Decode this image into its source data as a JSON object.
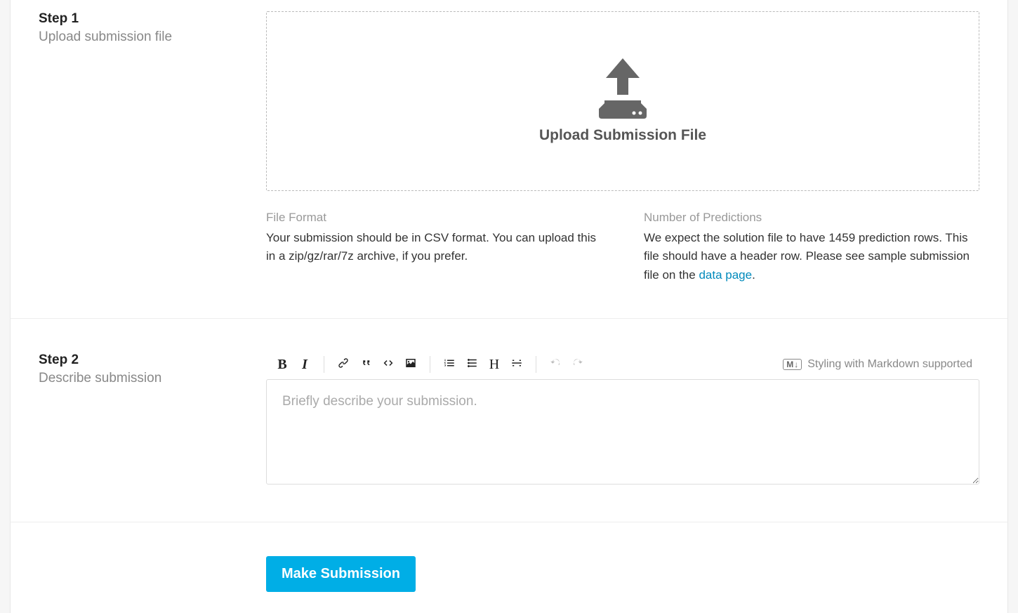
{
  "step1": {
    "num": "Step 1",
    "title": "Upload submission file",
    "dropzone_label": "Upload Submission File",
    "info": {
      "format_heading": "File Format",
      "format_body": "Your submission should be in CSV format. You can upload this in a zip/gz/rar/7z archive, if you prefer.",
      "predictions_heading": "Number of Predictions",
      "predictions_body_prefix": "We expect the solution file to have 1459 prediction rows. This file should have a header row. Please see sample submission file on the ",
      "predictions_link_text": "data page",
      "predictions_body_suffix": "."
    }
  },
  "step2": {
    "num": "Step 2",
    "title": "Describe submission",
    "placeholder": "Briefly describe your submission.",
    "markdown_hint": "Styling with Markdown supported",
    "markdown_badge": "M"
  },
  "submit_label": "Make Submission"
}
